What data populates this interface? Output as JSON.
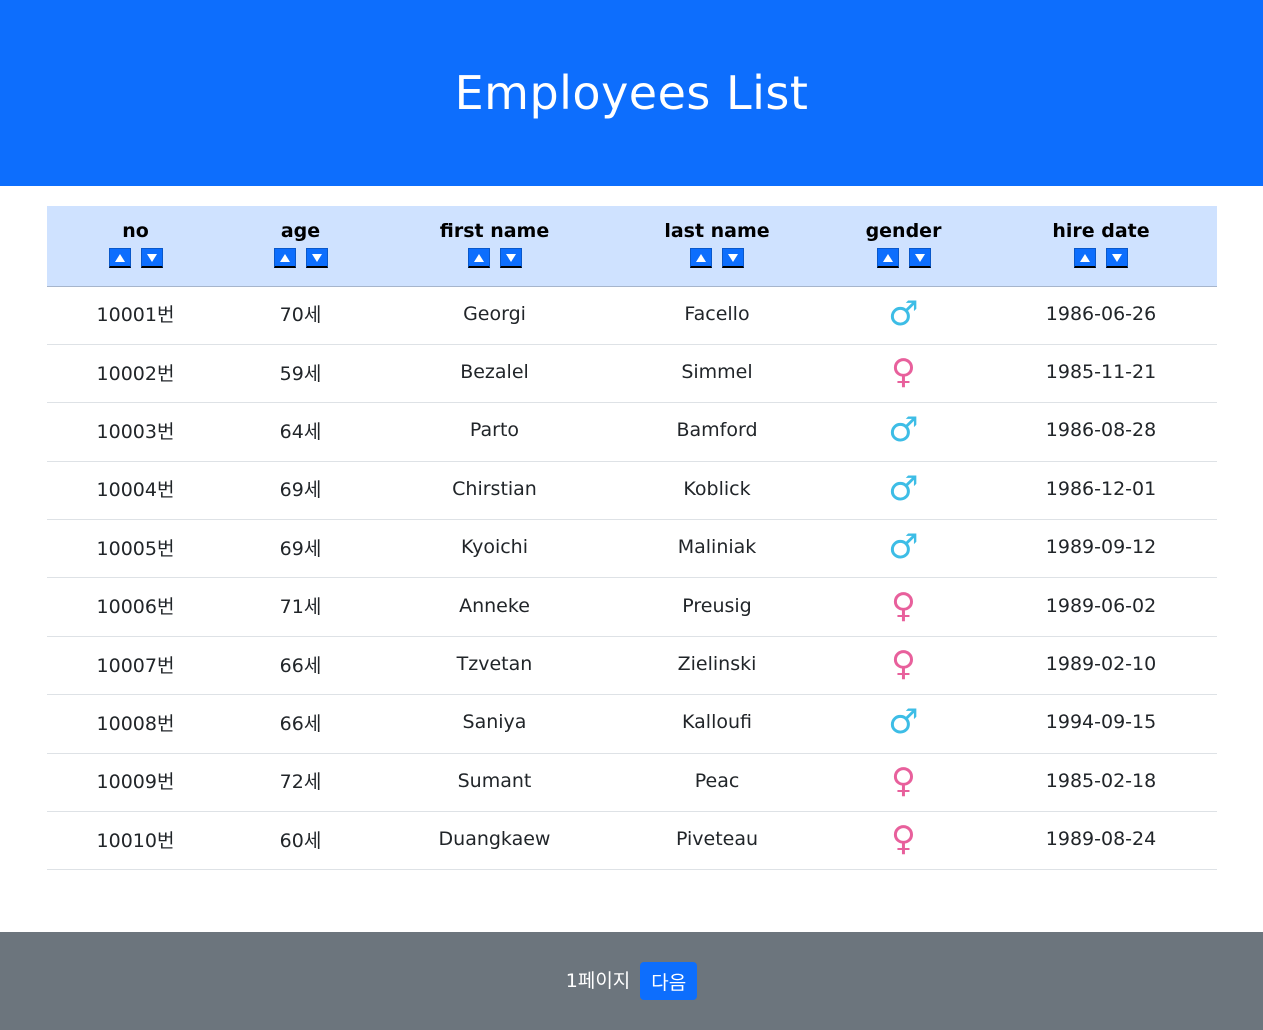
{
  "header": {
    "title": "Employees List"
  },
  "colors": {
    "primary": "#0d6efd",
    "header_row": "#cfe2ff",
    "male": "#3dbde6",
    "female": "#e8609c",
    "footer": "#6c757d"
  },
  "table": {
    "columns": [
      {
        "label": "no"
      },
      {
        "label": "age"
      },
      {
        "label": "first name"
      },
      {
        "label": "last name"
      },
      {
        "label": "gender"
      },
      {
        "label": "hire date"
      }
    ],
    "sort_icons": {
      "asc": "triangle-up-icon",
      "desc": "triangle-down-icon"
    },
    "rows": [
      {
        "no": "10001번",
        "age": "70세",
        "first_name": "Georgi",
        "last_name": "Facello",
        "gender": "male",
        "gender_symbol": "♂",
        "hire_date": "1986-06-26"
      },
      {
        "no": "10002번",
        "age": "59세",
        "first_name": "Bezalel",
        "last_name": "Simmel",
        "gender": "female",
        "gender_symbol": "♀",
        "hire_date": "1985-11-21"
      },
      {
        "no": "10003번",
        "age": "64세",
        "first_name": "Parto",
        "last_name": "Bamford",
        "gender": "male",
        "gender_symbol": "♂",
        "hire_date": "1986-08-28"
      },
      {
        "no": "10004번",
        "age": "69세",
        "first_name": "Chirstian",
        "last_name": "Koblick",
        "gender": "male",
        "gender_symbol": "♂",
        "hire_date": "1986-12-01"
      },
      {
        "no": "10005번",
        "age": "69세",
        "first_name": "Kyoichi",
        "last_name": "Maliniak",
        "gender": "male",
        "gender_symbol": "♂",
        "hire_date": "1989-09-12"
      },
      {
        "no": "10006번",
        "age": "71세",
        "first_name": "Anneke",
        "last_name": "Preusig",
        "gender": "female",
        "gender_symbol": "♀",
        "hire_date": "1989-06-02"
      },
      {
        "no": "10007번",
        "age": "66세",
        "first_name": "Tzvetan",
        "last_name": "Zielinski",
        "gender": "female",
        "gender_symbol": "♀",
        "hire_date": "1989-02-10"
      },
      {
        "no": "10008번",
        "age": "66세",
        "first_name": "Saniya",
        "last_name": "Kalloufi",
        "gender": "male",
        "gender_symbol": "♂",
        "hire_date": "1994-09-15"
      },
      {
        "no": "10009번",
        "age": "72세",
        "first_name": "Sumant",
        "last_name": "Peac",
        "gender": "female",
        "gender_symbol": "♀",
        "hire_date": "1985-02-18"
      },
      {
        "no": "10010번",
        "age": "60세",
        "first_name": "Duangkaew",
        "last_name": "Piveteau",
        "gender": "female",
        "gender_symbol": "♀",
        "hire_date": "1989-08-24"
      }
    ]
  },
  "footer": {
    "page_label": "1페이지",
    "next_label": "다음"
  }
}
